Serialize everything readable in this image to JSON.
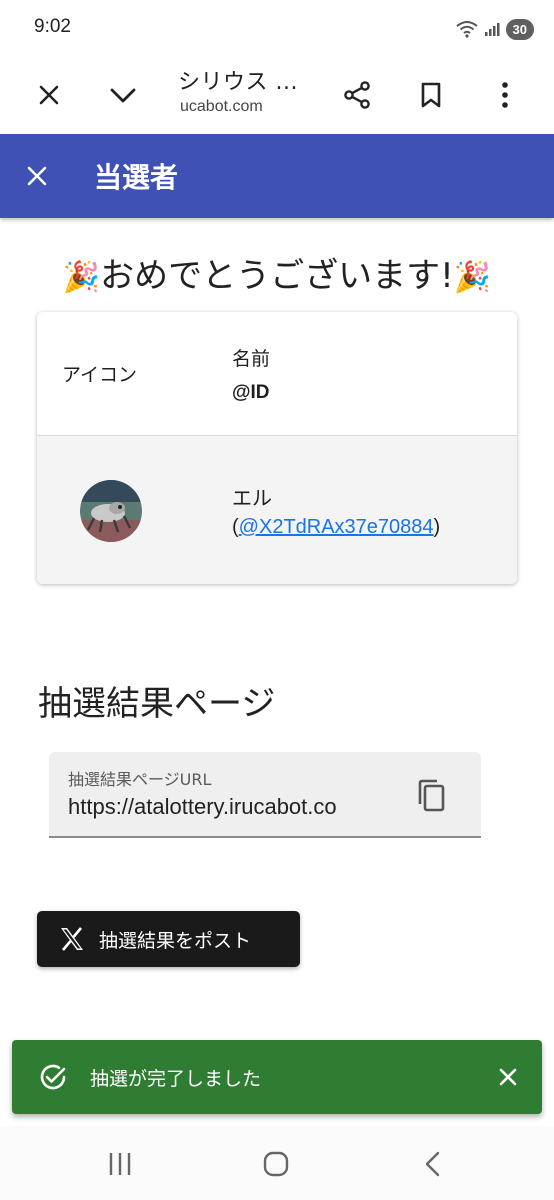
{
  "status_bar": {
    "time": "9:02",
    "battery": "30"
  },
  "browser": {
    "title": "シリウス ...",
    "url": "ucabot.com"
  },
  "app_bar": {
    "title": "当選者"
  },
  "congrats": {
    "text": "おめでとうございます!"
  },
  "winner_table": {
    "headers": {
      "icon": "アイコン",
      "name": "名前",
      "id": "@ID"
    },
    "rows": [
      {
        "name": "エル",
        "id_prefix": "(",
        "id": "@X2TdRAx37e70884",
        "id_suffix": ")"
      }
    ]
  },
  "result_section": {
    "title": "抽選結果ページ",
    "url_field": {
      "label": "抽選結果ページURL",
      "value": "https://atalottery.irucabot.co"
    }
  },
  "post_button": {
    "label": "抽選結果をポスト",
    "icon": "x-logo-icon"
  },
  "snackbar": {
    "message": "抽選が完了しました",
    "color": "#2e7d32"
  },
  "colors": {
    "app_bar": "#3f51b5",
    "link": "#1a73e8",
    "post_button": "#1a1a1a"
  }
}
